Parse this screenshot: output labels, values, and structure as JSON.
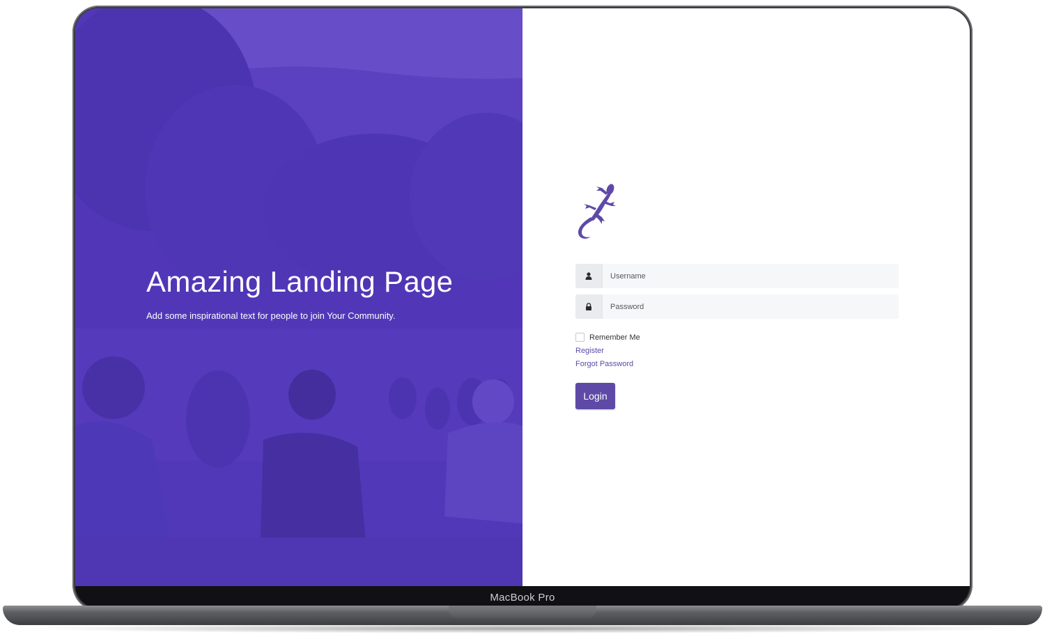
{
  "device": {
    "label": "MacBook Pro"
  },
  "hero": {
    "title": "Amazing Landing Page",
    "subtitle": "Add some inspirational text for people to join Your Community."
  },
  "login": {
    "logo_icon": "gecko-icon",
    "username": {
      "placeholder": "Username",
      "value": "",
      "icon": "user-icon"
    },
    "password": {
      "placeholder": "Password",
      "value": "",
      "icon": "lock-icon"
    },
    "remember_label": "Remember Me",
    "remember_checked": false,
    "register_label": "Register",
    "forgot_label": "Forgot Password",
    "login_label": "Login"
  },
  "colors": {
    "brand_purple": "#5e4aa6",
    "hero_overlay": "#583cc8"
  }
}
